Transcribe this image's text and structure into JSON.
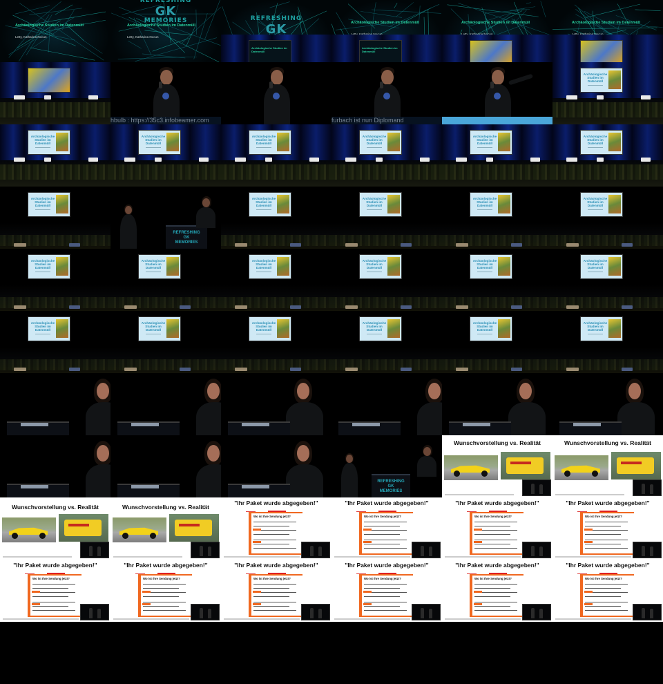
{
  "intro": {
    "logo_line1": "REFRESHING",
    "logo_mark": "GK",
    "logo_line3": "MEMORIES",
    "talk_title": "Archäologische Studien im Datenmüll",
    "speakers": "Letty, Katharina Nocun"
  },
  "slide_title": {
    "line1": "Archäologische",
    "line2": "Studien im Datenmüll"
  },
  "tickers": [
    "hbulb : https://35c3.infobeamer.com",
    "furbach ist nun Diplomand"
  ],
  "lectern_text": {
    "line1": "REFRESHING",
    "line2": "GK",
    "line3": "MEMORIES"
  },
  "slides": {
    "wunsch_title": "Wunschvorstellung vs. Realität",
    "paket_title": "\"Ihr Paket wurde abgegeben!\"",
    "form_title": "Wo ist Ihre Sendung jetzt?"
  },
  "colors": {
    "neon_green": "#29d2a0",
    "stage_blue": "#0c2480",
    "slide_blue": "#cfe9f5",
    "form_orange": "#f06820",
    "car_yellow": "#f2d21a"
  },
  "frames": [
    "intro-network",
    "intro-logo",
    "intro-logo-stage",
    "intro-title-stage",
    "intro-title-stage-yellow",
    "intro-title-stage-yellow",
    "stage-yellow",
    "speaker-m",
    "speaker-m",
    "speaker-m",
    "speaker-m-point",
    "stage-slide",
    "stage-slide",
    "stage-slide",
    "stage-slide",
    "stage-slide",
    "stage-slide",
    "stage-slide",
    "dim-slide",
    "two-speakers",
    "dim-slide",
    "dim-slide",
    "dim-slide",
    "dim-slide",
    "dim-slide",
    "dim-slide",
    "dim-slide",
    "dim-slide",
    "dim-slide",
    "dim-slide",
    "dim-slide",
    "dim-slide",
    "dim-slide",
    "dim-slide",
    "dim-slide",
    "dim-slide",
    "closeup-f",
    "closeup-f",
    "closeup-f",
    "closeup-f",
    "closeup-f-side",
    "closeup-f",
    "closeup-f",
    "closeup-f",
    "closeup-f",
    "two-speakers-close",
    "wunsch",
    "wunsch",
    "wunsch",
    "wunsch",
    "paket",
    "paket",
    "paket",
    "paket",
    "paket",
    "paket",
    "paket",
    "paket",
    "paket",
    "paket"
  ]
}
